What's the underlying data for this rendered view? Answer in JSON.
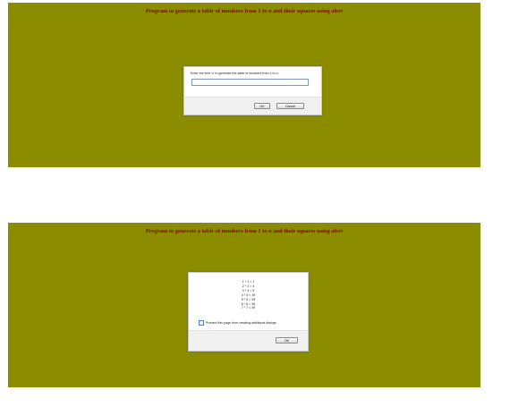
{
  "heading": "Program to generate a table of numbers from 1 to n and their squares using alert",
  "prompt_dialog": {
    "message": "Enter the limit 'n' to generate the table of numbers from 1 to n:",
    "input_value": "",
    "ok_label": "OK",
    "cancel_label": "Cancel"
  },
  "alert_dialog": {
    "lines": [
      "1 * 1 = 1",
      "2 * 2 = 4",
      "3 * 3 = 9",
      "4 * 4 = 16",
      "5 * 5 = 25",
      "6 * 6 = 36",
      "7 * 7 = 49"
    ],
    "prevent_label": "Prevent this page from creating additional dialogs",
    "prevent_checked": false,
    "ok_label": "OK"
  },
  "colors": {
    "panel_background": "#8b8c00",
    "heading_text": "#8b0000"
  }
}
